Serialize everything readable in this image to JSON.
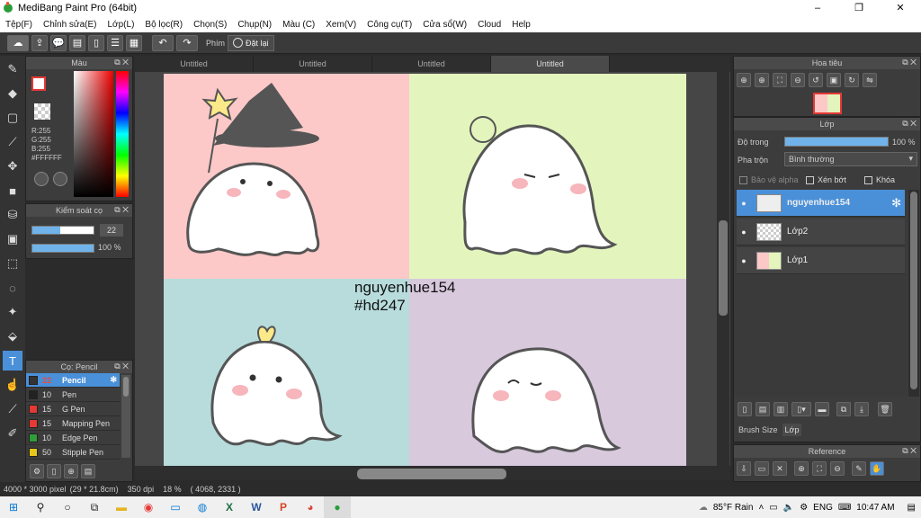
{
  "window": {
    "title": "MediBang Paint Pro (64bit)",
    "minimize": "–",
    "maximize": "❐",
    "close": "✕"
  },
  "menu": [
    "Tệp(F)",
    "Chỉnh sửa(E)",
    "Lớp(L)",
    "Bộ lọc(R)",
    "Chọn(S)",
    "Chụp(N)",
    "Màu (C)",
    "Xem(V)",
    "Công cụ(T)",
    "Cửa sổ(W)",
    "Cloud",
    "Help"
  ],
  "toolbar": {
    "shortcut_label": "Phím",
    "reset_label": "Đặt lại"
  },
  "color_panel": {
    "title": "Màu",
    "r": "R:255",
    "g": "G:255",
    "b": "B:255",
    "hex": "#FFFFFF",
    "current_color": "#FFFFFF",
    "accent": "#e53935"
  },
  "brush_control": {
    "title": "Kiểm soát cọ",
    "size": "22",
    "opacity": "100 %",
    "size_level": 0.45,
    "opacity_level": 1.0
  },
  "brush_panel": {
    "title": "Cọ: Pencil",
    "items": [
      {
        "size": "22",
        "name": "Pencil",
        "color": "#333333",
        "selected": true
      },
      {
        "size": "10",
        "name": "Pen",
        "color": "#222222",
        "selected": false
      },
      {
        "size": "15",
        "name": "G Pen",
        "color": "#e53935",
        "selected": false
      },
      {
        "size": "15",
        "name": "Mapping Pen",
        "color": "#e53935",
        "selected": false
      },
      {
        "size": "10",
        "name": "Edge Pen",
        "color": "#2e9d3a",
        "selected": false
      },
      {
        "size": "50",
        "name": "Stipple Pen",
        "color": "#e6c619",
        "selected": false
      }
    ]
  },
  "tabs": [
    "Untitled",
    "Untitled",
    "Untitled",
    "Untitled"
  ],
  "canvas": {
    "text_line1": "nguyenhue154",
    "text_line2": "#hd247"
  },
  "navigator": {
    "title": "Hoa tiêu"
  },
  "layer_panel": {
    "title": "Lớp",
    "opacity_label": "Độ trong",
    "opacity_value": "100 %",
    "opacity_level": 1.0,
    "blend_label": "Pha trộn",
    "blend_value": "Bình thường",
    "protect_alpha": "Bảo vệ alpha",
    "clipping": "Xén bớt",
    "lock": "Khóa",
    "layers": [
      {
        "name": "nguyenhue154",
        "selected": true
      },
      {
        "name": "Lớp2",
        "selected": false
      },
      {
        "name": "Lớp1",
        "selected": false
      }
    ]
  },
  "bottom_tabs": {
    "brush_size": "Brush Size",
    "layer": "Lớp"
  },
  "reference": {
    "title": "Reference"
  },
  "status": {
    "dimensions": "4000 * 3000 pixel",
    "cm": "(29 * 21.8cm)",
    "dpi": "350 dpi",
    "zoom": "18 %",
    "coords": "( 4068, 2331 )"
  },
  "taskbar": {
    "weather": "85°F  Rain",
    "lang": "ENG",
    "time": "10:47 AM"
  }
}
